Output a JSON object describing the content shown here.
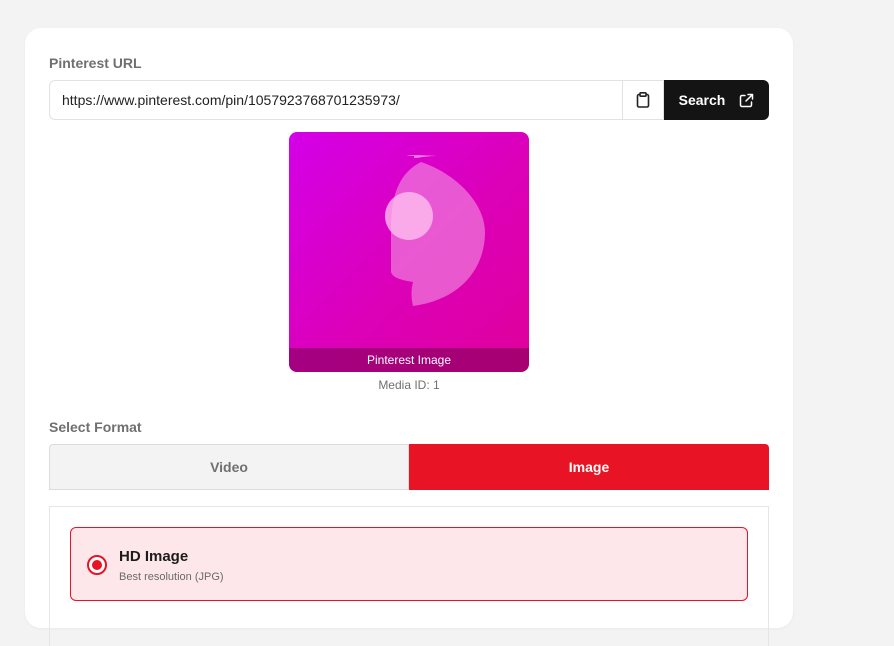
{
  "form": {
    "url_label": "Pinterest URL",
    "url_value": "https://www.pinterest.com/pin/1057923768701235973/",
    "paste_icon": "clipboard-icon",
    "search_label": "Search",
    "search_icon": "external-link-icon"
  },
  "preview": {
    "caption": "Pinterest Image",
    "media_id": "Media ID: 1"
  },
  "format": {
    "label": "Select Format",
    "tabs": [
      {
        "label": "Video",
        "active": false
      },
      {
        "label": "Image",
        "active": true
      }
    ]
  },
  "options": [
    {
      "title": "HD Image",
      "subtitle": "Best resolution (JPG)",
      "selected": true
    }
  ],
  "colors": {
    "accent": "#e81325",
    "dark_button": "#141414",
    "preview_gradient_start": "#d400e8",
    "preview_gradient_end": "#e0009a"
  }
}
